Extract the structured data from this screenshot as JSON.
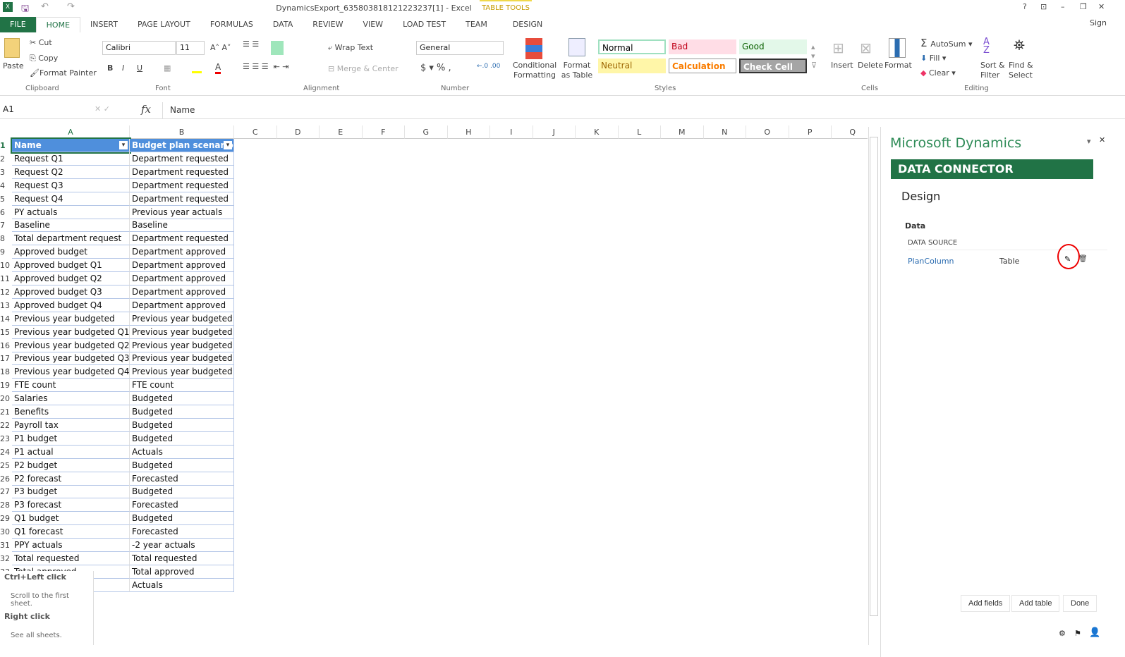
{
  "window": {
    "title": "DynamicsExport_635803818121223237[1] - Excel",
    "context_tab": "TABLE TOOLS",
    "sign_in": "Sign"
  },
  "tabs": [
    "FILE",
    "HOME",
    "INSERT",
    "PAGE LAYOUT",
    "FORMULAS",
    "DATA",
    "REVIEW",
    "VIEW",
    "LOAD TEST",
    "TEAM",
    "DESIGN"
  ],
  "ribbon": {
    "clipboard": {
      "paste": "Paste",
      "cut": "Cut",
      "copy": "Copy",
      "format_painter": "Format Painter",
      "label": "Clipboard"
    },
    "font": {
      "name": "Calibri",
      "size": "11",
      "label": "Font"
    },
    "alignment": {
      "wrap": "Wrap Text",
      "merge": "Merge & Center",
      "label": "Alignment"
    },
    "number": {
      "format": "General",
      "label": "Number"
    },
    "styles": {
      "conditional": "Conditional Formatting",
      "format_table": "Format as Table",
      "normal": "Normal",
      "bad": "Bad",
      "good": "Good",
      "neutral": "Neutral",
      "calculation": "Calculation",
      "check": "Check Cell",
      "label": "Styles"
    },
    "cells": {
      "insert": "Insert",
      "delete": "Delete",
      "format": "Format",
      "label": "Cells"
    },
    "editing": {
      "autosum": "AutoSum",
      "fill": "Fill",
      "clear": "Clear",
      "sort": "Sort & Filter",
      "find": "Find & Select",
      "label": "Editing"
    }
  },
  "formula_bar": {
    "name_box": "A1",
    "fx": "fx",
    "value": "Name"
  },
  "columns": [
    "A",
    "B",
    "C",
    "D",
    "E",
    "F",
    "G",
    "H",
    "I",
    "J",
    "K",
    "L",
    "M",
    "N",
    "O",
    "P",
    "Q"
  ],
  "table": {
    "headers": [
      "Name",
      "Budget plan scenario"
    ],
    "rows": [
      [
        "Request Q1",
        "Department requested"
      ],
      [
        "Request Q2",
        "Department requested"
      ],
      [
        "Request Q3",
        "Department requested"
      ],
      [
        "Request Q4",
        "Department requested"
      ],
      [
        "PY actuals",
        "Previous year actuals"
      ],
      [
        "Baseline",
        "Baseline"
      ],
      [
        "Total department request",
        "Department requested"
      ],
      [
        "Approved budget",
        "Department approved"
      ],
      [
        "Approved budget Q1",
        "Department approved"
      ],
      [
        "Approved budget Q2",
        "Department approved"
      ],
      [
        "Approved budget Q3",
        "Department approved"
      ],
      [
        "Approved budget Q4",
        "Department approved"
      ],
      [
        "Previous year budgeted",
        "Previous year budgeted"
      ],
      [
        "Previous year budgeted Q1",
        "Previous year budgeted"
      ],
      [
        "Previous year budgeted Q2",
        "Previous year budgeted"
      ],
      [
        "Previous year budgeted Q3",
        "Previous year budgeted"
      ],
      [
        "Previous year budgeted Q4",
        "Previous year budgeted"
      ],
      [
        "FTE count",
        "FTE count"
      ],
      [
        "Salaries",
        "Budgeted"
      ],
      [
        "Benefits",
        "Budgeted"
      ],
      [
        "Payroll tax",
        "Budgeted"
      ],
      [
        "P1 budget",
        "Budgeted"
      ],
      [
        "P1 actual",
        "Actuals"
      ],
      [
        "P2 budget",
        "Budgeted"
      ],
      [
        "P2 forecast",
        "Forecasted"
      ],
      [
        "P3 budget",
        "Budgeted"
      ],
      [
        "P3 forecast",
        "Forecasted"
      ],
      [
        "Q1 budget",
        "Budgeted"
      ],
      [
        "Q1 forecast",
        "Forecasted"
      ],
      [
        "PPY actuals",
        "-2 year actuals"
      ],
      [
        "Total requested",
        "Total requested"
      ],
      [
        "Total approved",
        "Total approved"
      ],
      [
        "",
        "Actuals"
      ]
    ]
  },
  "tooltip": {
    "title1": "Ctrl+Left click",
    "desc1": "Scroll to the first sheet.",
    "title2": "Right click",
    "desc2": "See all sheets."
  },
  "pane": {
    "brand": "Microsoft Dynamics",
    "banner": "DATA CONNECTOR",
    "heading": "Design",
    "section": "Data",
    "column_header": "DATA SOURCE",
    "source_name": "PlanColumn",
    "source_type": "Table",
    "add_fields": "Add fields",
    "add_table": "Add table",
    "done": "Done",
    "accent": "#217346"
  }
}
